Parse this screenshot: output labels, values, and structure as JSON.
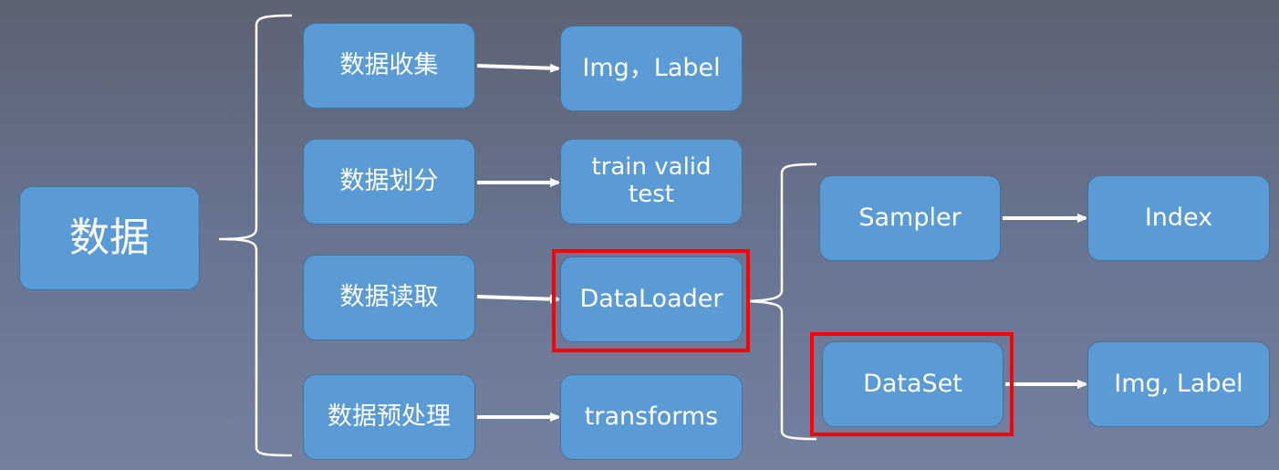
{
  "diagram": {
    "root": {
      "label": "数据"
    },
    "stages": [
      {
        "label": "数据收集",
        "output": "Img，Label"
      },
      {
        "label": "数据划分",
        "output": "train valid\ntest"
      },
      {
        "label": "数据读取",
        "output": "DataLoader",
        "highlighted": true
      },
      {
        "label": "数据预处理",
        "output": "transforms"
      }
    ],
    "dataloader_components": [
      {
        "label": "Sampler",
        "output": "Index",
        "highlighted": false
      },
      {
        "label": "DataSet",
        "output": "Img, Label",
        "highlighted": true
      }
    ],
    "colors": {
      "box_fill": "#5b9bd5",
      "box_border": "#41719c",
      "text": "#ffffff",
      "connector": "#ffffff",
      "highlight": "#ff0000",
      "background_top": "#5d6272",
      "background_bottom": "#7380a0"
    }
  }
}
